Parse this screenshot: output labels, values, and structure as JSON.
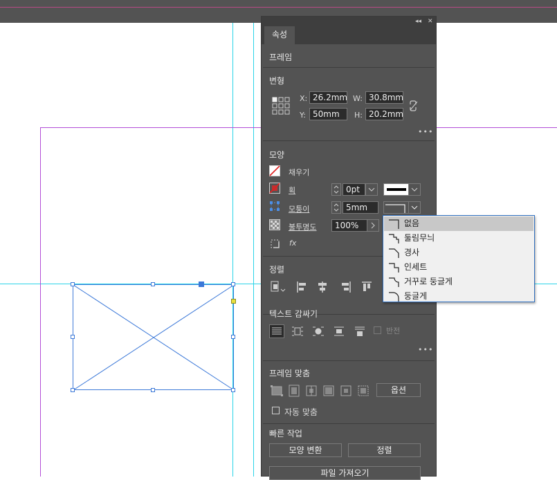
{
  "panel": {
    "tab_label": "속성",
    "object_type": "프레임",
    "panel_controls": {
      "collapse": "◂◂",
      "close": "✕"
    }
  },
  "transform": {
    "title": "변형",
    "x_label": "X:",
    "x_value": "26.2mm",
    "y_label": "Y:",
    "y_value": "50mm",
    "w_label": "W:",
    "w_value": "30.8mm",
    "h_label": "H:",
    "h_value": "20.2mm",
    "more": "•••"
  },
  "appearance": {
    "title": "모양",
    "fill_label": "채우기",
    "stroke_label": "획",
    "stroke_weight": "0pt",
    "corner_label": "모퉁이",
    "corner_size": "5mm",
    "opacity_label": "불투명도",
    "opacity_value": "100%",
    "fx_label": "fx"
  },
  "corner_menu": {
    "items": [
      "없음",
      "둘림무늬",
      "경사",
      "인세트",
      "거꾸로 둥글게",
      "둥글게"
    ],
    "selected_index": 0
  },
  "align": {
    "title": "정렬"
  },
  "text_wrap": {
    "title": "텍스트 감싸기",
    "invert_label": "반전",
    "more": "•••"
  },
  "frame_fitting": {
    "title": "프레임 맞춤",
    "options_label": "옵션",
    "auto_fit_label": "자동 맞춤"
  },
  "quick_actions": {
    "title": "빠른 작업",
    "convert_shape_label": "모양 변환",
    "align_label": "정렬",
    "import_file_label": "파일 가져오기"
  },
  "colors": {
    "panel_bg": "#535353",
    "panel_dark": "#3e3e3e",
    "guide": "#29d4e8",
    "margin": "#b24bd6",
    "selection": "#3b78d8",
    "menu_bg": "#f0f0f0",
    "menu_border": "#2f6fbf"
  }
}
